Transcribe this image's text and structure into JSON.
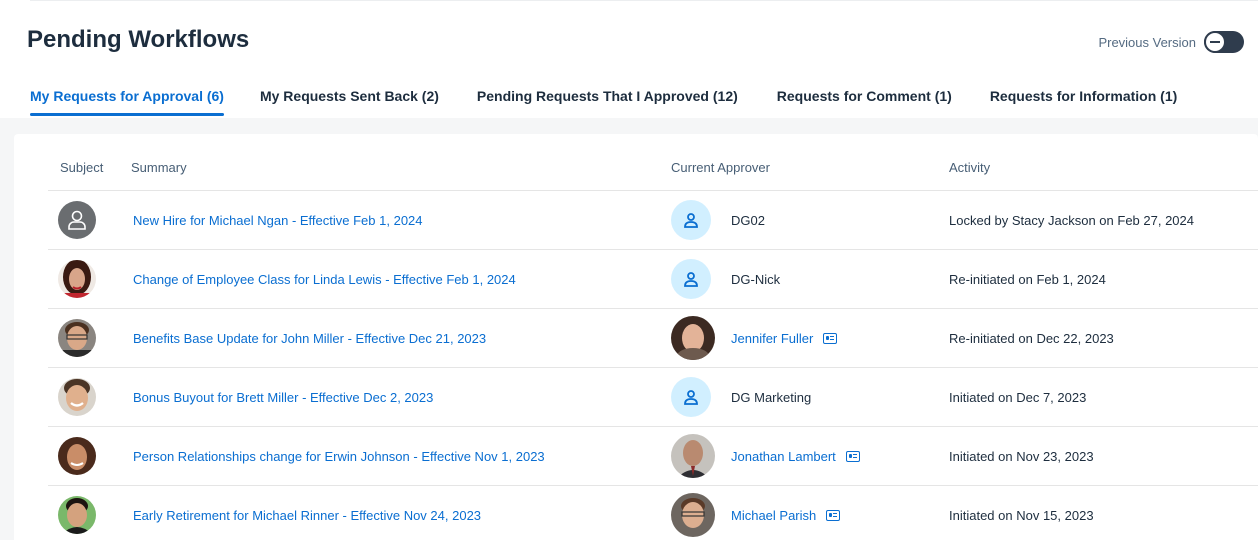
{
  "page": {
    "title": "Pending Workflows",
    "previous_version_label": "Previous Version"
  },
  "tabs": [
    {
      "label": "My Requests for Approval (6)",
      "active": true
    },
    {
      "label": "My Requests Sent Back (2)",
      "active": false
    },
    {
      "label": "Pending Requests That I Approved (12)",
      "active": false
    },
    {
      "label": "Requests for Comment (1)",
      "active": false
    },
    {
      "label": "Requests for Information (1)",
      "active": false
    }
  ],
  "table": {
    "columns": [
      "Subject",
      "Summary",
      "Current Approver",
      "Activity"
    ],
    "rows": [
      {
        "subject_avatar": "generic-person-icon",
        "summary": "New Hire for Michael Ngan - Effective Feb 1, 2024",
        "approver": "DG02",
        "approver_type": "group",
        "activity": "Locked by Stacy Jackson on Feb 27, 2024"
      },
      {
        "subject_avatar": "photo",
        "summary": "Change of Employee Class for Linda Lewis - Effective Feb 1, 2024",
        "approver": "DG-Nick",
        "approver_type": "group",
        "activity": "Re-initiated on Feb 1, 2024"
      },
      {
        "subject_avatar": "photo",
        "summary": "Benefits Base Update for John Miller - Effective Dec 21, 2023",
        "approver": "Jennifer Fuller",
        "approver_type": "person",
        "activity": "Re-initiated on Dec 22, 2023"
      },
      {
        "subject_avatar": "photo",
        "summary": "Bonus Buyout for Brett Miller - Effective Dec 2, 2023",
        "approver": "DG Marketing",
        "approver_type": "group",
        "activity": "Initiated on Dec 7, 2023"
      },
      {
        "subject_avatar": "photo",
        "summary": "Person Relationships change for Erwin Johnson - Effective Nov 1, 2023",
        "approver": "Jonathan Lambert",
        "approver_type": "person",
        "activity": "Initiated on Nov 23, 2023"
      },
      {
        "subject_avatar": "photo",
        "summary": "Early Retirement for Michael Rinner - Effective Nov 24, 2023",
        "approver": "Michael Parish",
        "approver_type": "person",
        "activity": "Initiated on Nov 15, 2023"
      }
    ]
  },
  "colors": {
    "accent": "#0a6ed1",
    "group_avatar_bg": "#d1efff",
    "generic_avatar_bg": "#6a6d70",
    "content_bg": "#f5f6f7"
  }
}
